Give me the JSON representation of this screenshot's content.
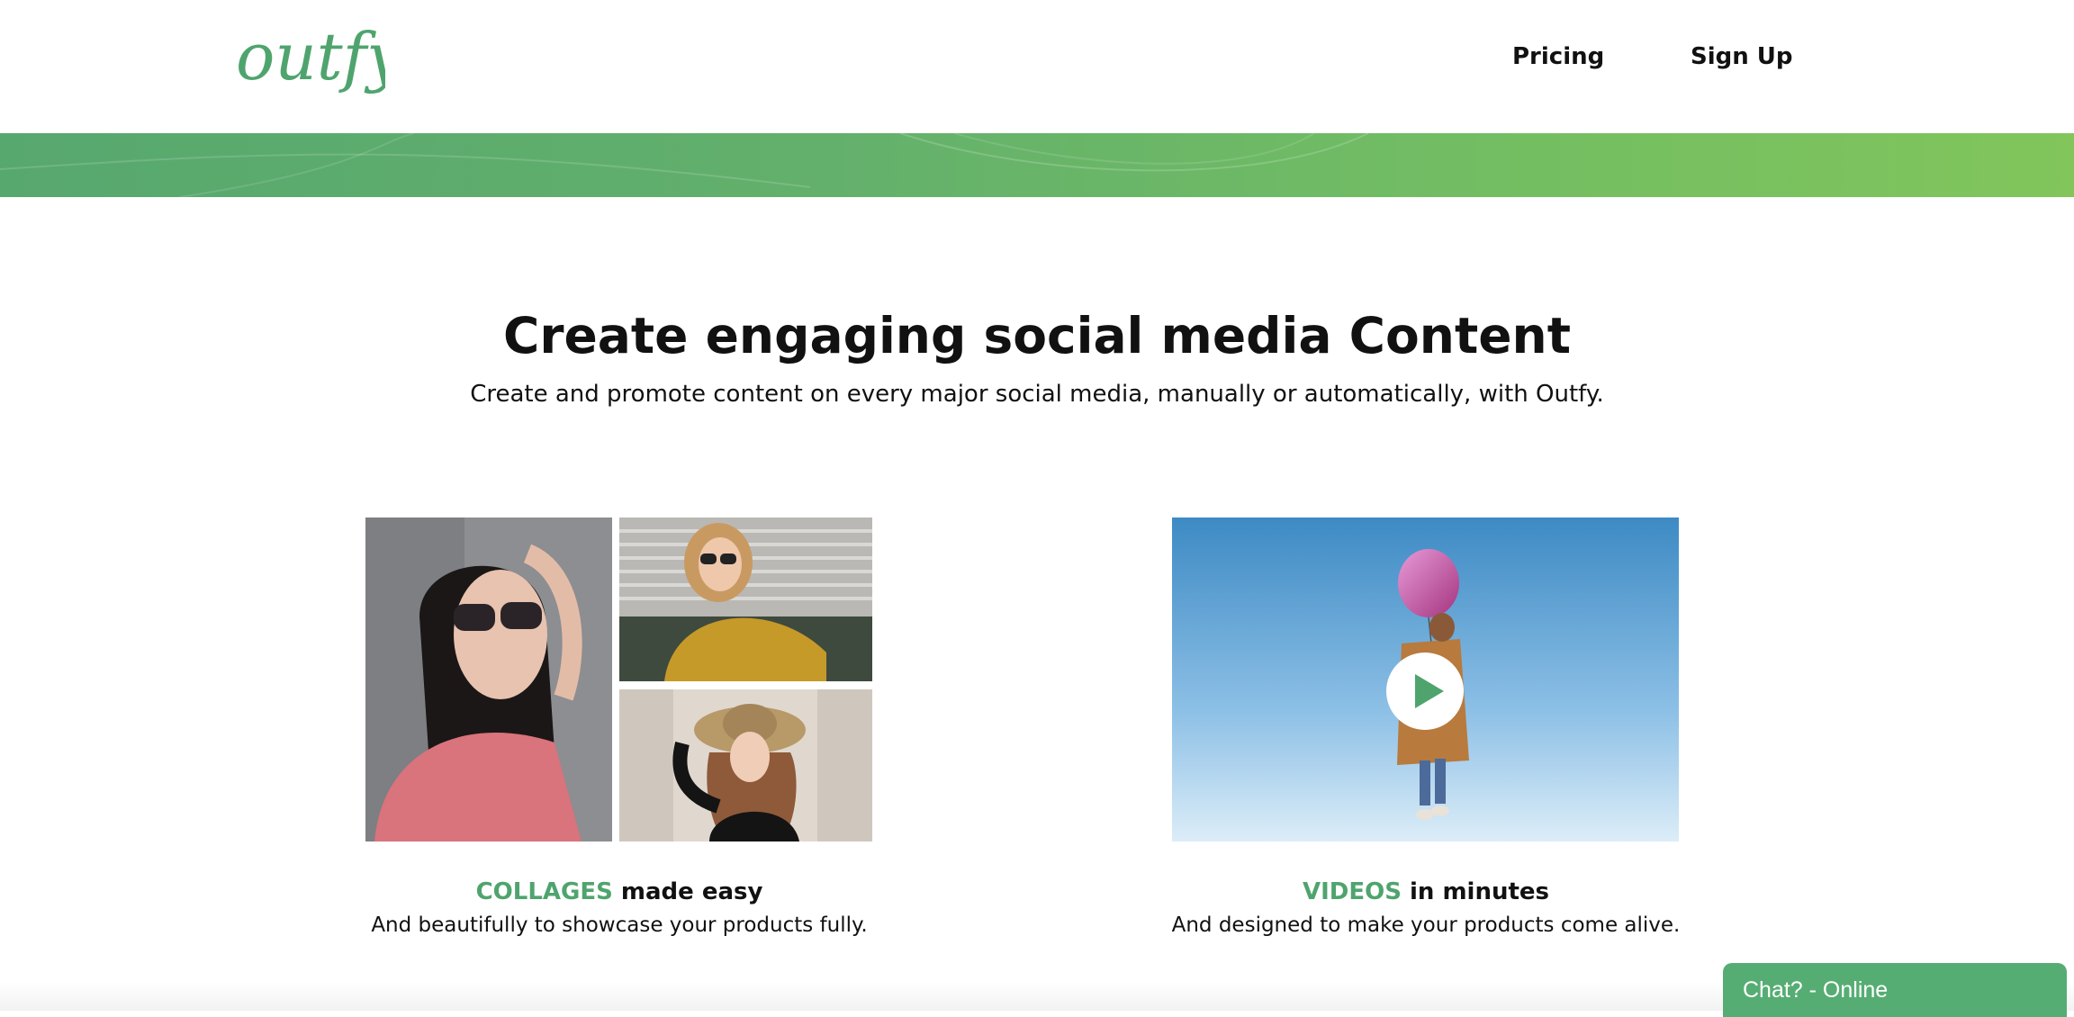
{
  "brand": {
    "name": "outfy",
    "accent_color": "#4fa46e",
    "banner_start_color": "#57a86f",
    "banner_end_color": "#81c55b"
  },
  "nav": {
    "pricing": "Pricing",
    "signup": "Sign Up"
  },
  "hero": {
    "title": "Create engaging social media Content",
    "subtitle": "Create and promote content on every major social media, manually or automatically, with Outfy."
  },
  "features": [
    {
      "highlight": "COLLAGES",
      "title_rest": " made easy",
      "description": "And beautifully to showcase your products fully.",
      "media": "photo-collage"
    },
    {
      "highlight": "VIDEOS",
      "title_rest": " in minutes",
      "description": "And designed to make your products come alive.",
      "media": "video-preview",
      "icon": "play-icon"
    }
  ],
  "chat": {
    "label": "Chat? - Online",
    "color": "#56ad73"
  }
}
